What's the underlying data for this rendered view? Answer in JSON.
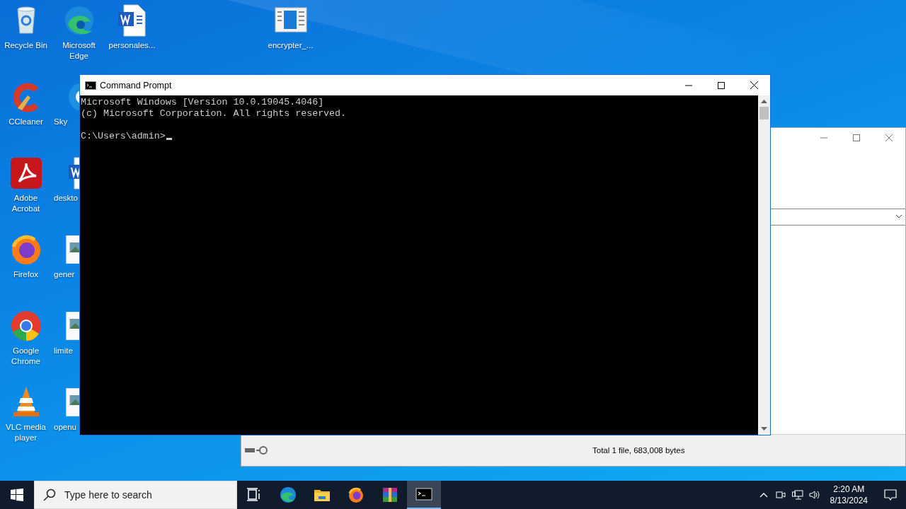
{
  "desktop_icons": [
    {
      "label": "Recycle Bin",
      "kind": "recycle"
    },
    {
      "label": "CCleaner",
      "kind": "ccleaner"
    },
    {
      "label": "Adobe Acrobat",
      "kind": "acrobat"
    },
    {
      "label": "Firefox",
      "kind": "firefox"
    },
    {
      "label": "Google Chrome",
      "kind": "chrome"
    },
    {
      "label": "VLC media player",
      "kind": "vlc"
    },
    {
      "label": "Microsoft Edge",
      "kind": "edge"
    },
    {
      "label": "Sky",
      "kind": "skype"
    },
    {
      "label": "deskto",
      "kind": "word"
    },
    {
      "label": "gener",
      "kind": "image"
    },
    {
      "label": "limite",
      "kind": "image"
    },
    {
      "label": "openu",
      "kind": "image"
    },
    {
      "label": "personales...",
      "kind": "word"
    },
    {
      "label": "encrypter_...",
      "kind": "app"
    }
  ],
  "background_window": {
    "status_text": "Total 1 file, 683,008 bytes"
  },
  "console_window": {
    "title": "Command Prompt",
    "output": [
      "Microsoft Windows [Version 10.0.19045.4046]",
      "(c) Microsoft Corporation. All rights reserved."
    ],
    "prompt": "C:\\Users\\admin>"
  },
  "taskbar": {
    "search": {
      "placeholder": "Type here to search"
    },
    "apps": [
      {
        "kind": "taskview",
        "selected": false
      },
      {
        "kind": "edge",
        "selected": false
      },
      {
        "kind": "explorer",
        "selected": false
      },
      {
        "kind": "firefox",
        "selected": false
      },
      {
        "kind": "winrar",
        "selected": false
      },
      {
        "kind": "console",
        "selected": true
      }
    ],
    "time": "2:20 AM",
    "date": "8/13/2024"
  }
}
